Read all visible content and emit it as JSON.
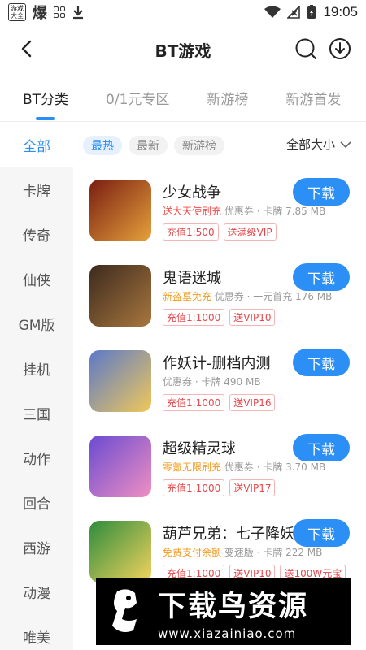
{
  "status_bar": {
    "app_label": "游戏大全",
    "bao_glyph": "爆",
    "time": "19:05"
  },
  "header": {
    "title": "BT游戏"
  },
  "tabs": [
    {
      "label": "BT分类",
      "active": true
    },
    {
      "label": "0/1元专区",
      "active": false
    },
    {
      "label": "新游榜",
      "active": false
    },
    {
      "label": "新游首发",
      "active": false
    }
  ],
  "sidebar": [
    {
      "label": "全部",
      "active": true
    },
    {
      "label": "卡牌"
    },
    {
      "label": "传奇"
    },
    {
      "label": "仙侠"
    },
    {
      "label": "GM版"
    },
    {
      "label": "挂机"
    },
    {
      "label": "三国"
    },
    {
      "label": "动作"
    },
    {
      "label": "回合"
    },
    {
      "label": "西游"
    },
    {
      "label": "动漫"
    },
    {
      "label": "唯美"
    }
  ],
  "filters": [
    {
      "label": "最热",
      "active": true
    },
    {
      "label": "最新"
    },
    {
      "label": "新游榜"
    }
  ],
  "size_dropdown": "全部大小",
  "download_label": "下载",
  "games": [
    {
      "name": "少女战争",
      "promo": "送大天使刷充",
      "meta": " 优惠券 · 卡牌  7.85 MB",
      "tags": [
        "充值1:500",
        "送满级VIP"
      ],
      "icon_colors": [
        "#7a1d12",
        "#e5a23b"
      ]
    },
    {
      "name": "鬼语迷城",
      "promo": "新盗墓免充",
      "meta": " 优惠券 · 一元首充  176 MB",
      "tags": [
        "充值1:1000",
        "送VIP10"
      ],
      "icon_colors": [
        "#3d2a1e",
        "#a8773e"
      ]
    },
    {
      "name": "作妖计-删档内测",
      "promo": "",
      "meta": "优惠券 · 卡牌  490 MB",
      "tags": [
        "充值1:1000",
        "送VIP16"
      ],
      "icon_colors": [
        "#5b79c8",
        "#f0c85a"
      ]
    },
    {
      "name": "超级精灵球",
      "promo": "零氪无限刷充",
      "meta": " 优惠券 · 卡牌  3.70 MB",
      "tags": [
        "充值1:1000",
        "送VIP17"
      ],
      "icon_colors": [
        "#6a4bd1",
        "#f08fc2"
      ]
    },
    {
      "name": "葫芦兄弟：七子降妖",
      "promo": "免费支付余额",
      "meta": " 变速版 · 卡牌  222 MB",
      "tags": [
        "充值1:1000",
        "送VIP10",
        "送100W元宝"
      ],
      "icon_colors": [
        "#2e8c3d",
        "#f4d35e"
      ]
    }
  ],
  "watermark": {
    "title": "下载鸟资源",
    "url": "www.xiazainiao.com"
  }
}
